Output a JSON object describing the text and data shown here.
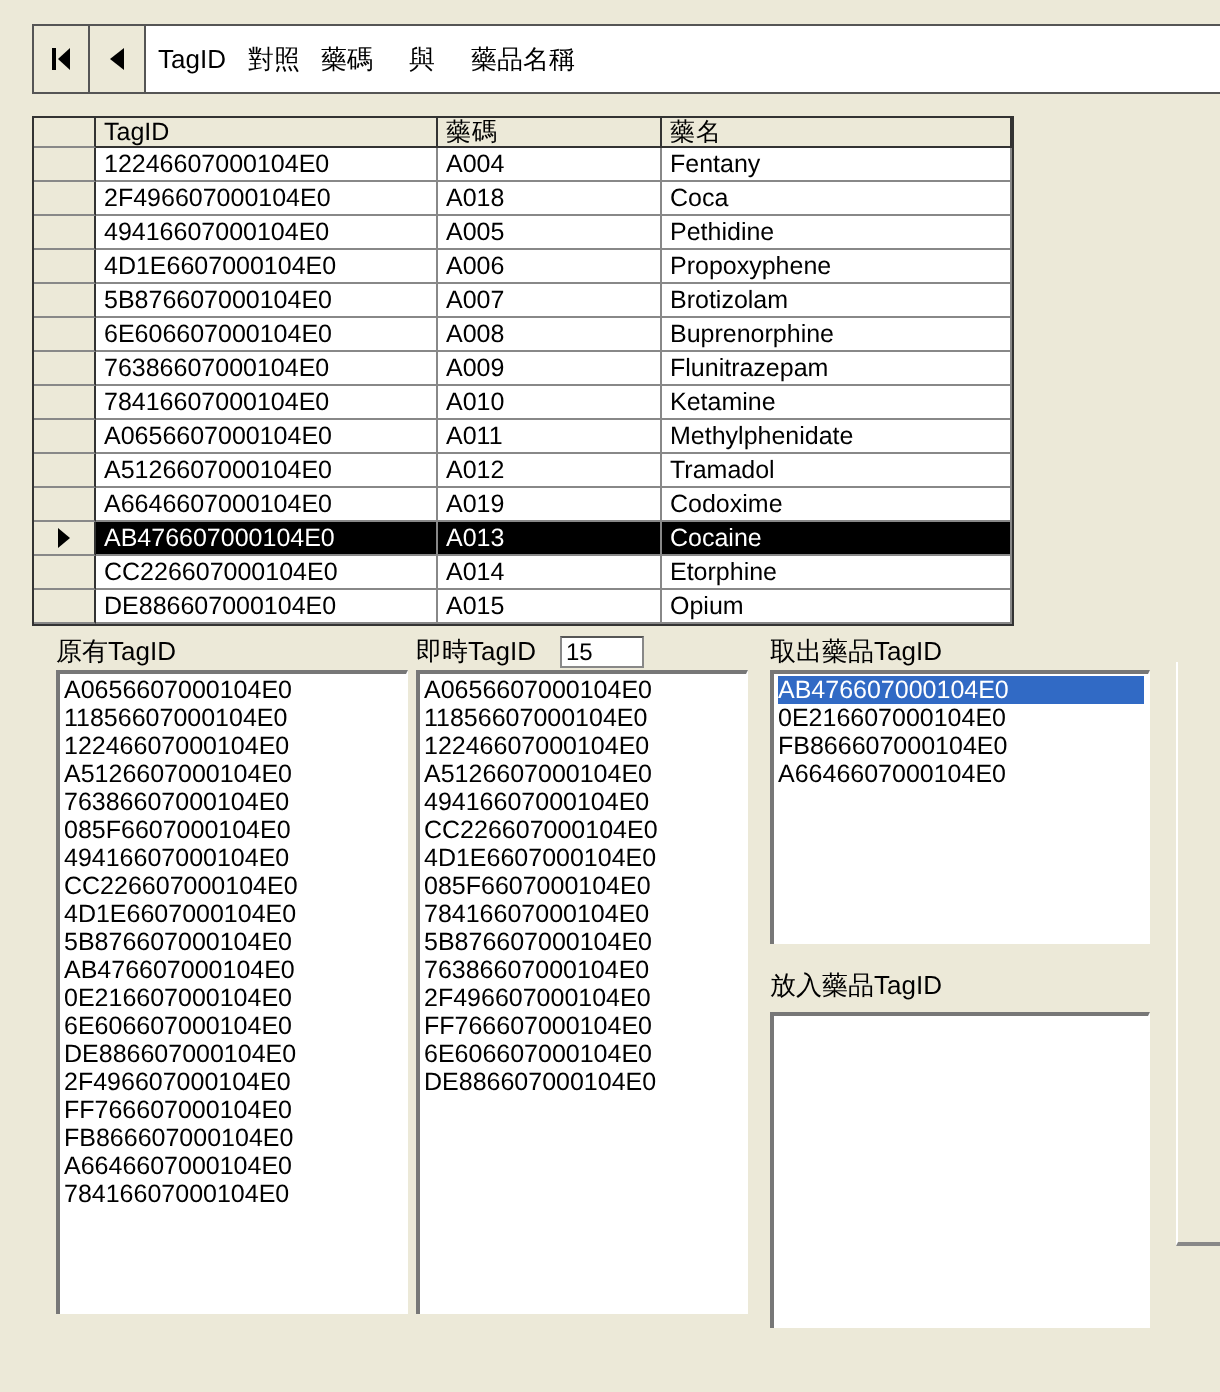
{
  "navigator": {
    "buttons": [
      {
        "kind": "first"
      },
      {
        "kind": "prev"
      }
    ],
    "caption": "TagID   對照   藥碼     與     藥品名稱"
  },
  "table": {
    "columns": [
      "TagID",
      "藥碼",
      "藥名"
    ],
    "rows": [
      {
        "cells": [
          "12246607000104E0",
          "A004",
          "Fentany"
        ],
        "selected": false
      },
      {
        "cells": [
          "2F496607000104E0",
          "A018",
          "Coca"
        ],
        "selected": false
      },
      {
        "cells": [
          "49416607000104E0",
          "A005",
          "Pethidine"
        ],
        "selected": false
      },
      {
        "cells": [
          "4D1E6607000104E0",
          "A006",
          "Propoxyphene"
        ],
        "selected": false
      },
      {
        "cells": [
          "5B876607000104E0",
          "A007",
          "Brotizolam"
        ],
        "selected": false
      },
      {
        "cells": [
          "6E606607000104E0",
          "A008",
          "Buprenorphine"
        ],
        "selected": false
      },
      {
        "cells": [
          "76386607000104E0",
          "A009",
          "Flunitrazepam"
        ],
        "selected": false
      },
      {
        "cells": [
          "78416607000104E0",
          "A010",
          "Ketamine"
        ],
        "selected": false
      },
      {
        "cells": [
          "A0656607000104E0",
          "A011",
          "Methylphenidate"
        ],
        "selected": false
      },
      {
        "cells": [
          "A5126607000104E0",
          "A012",
          "Tramadol"
        ],
        "selected": false
      },
      {
        "cells": [
          "A6646607000104E0",
          "A019",
          "Codoxime"
        ],
        "selected": false
      },
      {
        "cells": [
          "AB476607000104E0",
          "A013",
          "Cocaine"
        ],
        "selected": true
      },
      {
        "cells": [
          "CC226607000104E0",
          "A014",
          "Etorphine"
        ],
        "selected": false
      },
      {
        "cells": [
          "DE886607000104E0",
          "A015",
          "Opium"
        ],
        "selected": false
      }
    ]
  },
  "original_tags": {
    "label": "原有TagID",
    "items": [
      "A0656607000104E0",
      "11856607000104E0",
      "12246607000104E0",
      "A5126607000104E0",
      "76386607000104E0",
      "085F6607000104E0",
      "49416607000104E0",
      "CC226607000104E0",
      "4D1E6607000104E0",
      "5B876607000104E0",
      "AB476607000104E0",
      "0E216607000104E0",
      "6E606607000104E0",
      "DE886607000104E0",
      "2F496607000104E0",
      "FF766607000104E0",
      "FB866607000104E0",
      "A6646607000104E0",
      "78416607000104E0"
    ]
  },
  "live_tags": {
    "label": "即時TagID",
    "count": "15",
    "items": [
      "A0656607000104E0",
      "11856607000104E0",
      "12246607000104E0",
      "A5126607000104E0",
      "49416607000104E0",
      "CC226607000104E0",
      "4D1E6607000104E0",
      "085F6607000104E0",
      "78416607000104E0",
      "5B876607000104E0",
      "76386607000104E0",
      "2F496607000104E0",
      "FF766607000104E0",
      "6E606607000104E0",
      "DE886607000104E0"
    ]
  },
  "removed_tags": {
    "label": "取出藥品TagID",
    "items": [
      {
        "text": "AB476607000104E0",
        "selected": true
      },
      {
        "text": "0E216607000104E0",
        "selected": false
      },
      {
        "text": "FB866607000104E0",
        "selected": false
      },
      {
        "text": "A6646607000104E0",
        "selected": false
      }
    ]
  },
  "added_tags": {
    "label": "放入藥品TagID"
  }
}
